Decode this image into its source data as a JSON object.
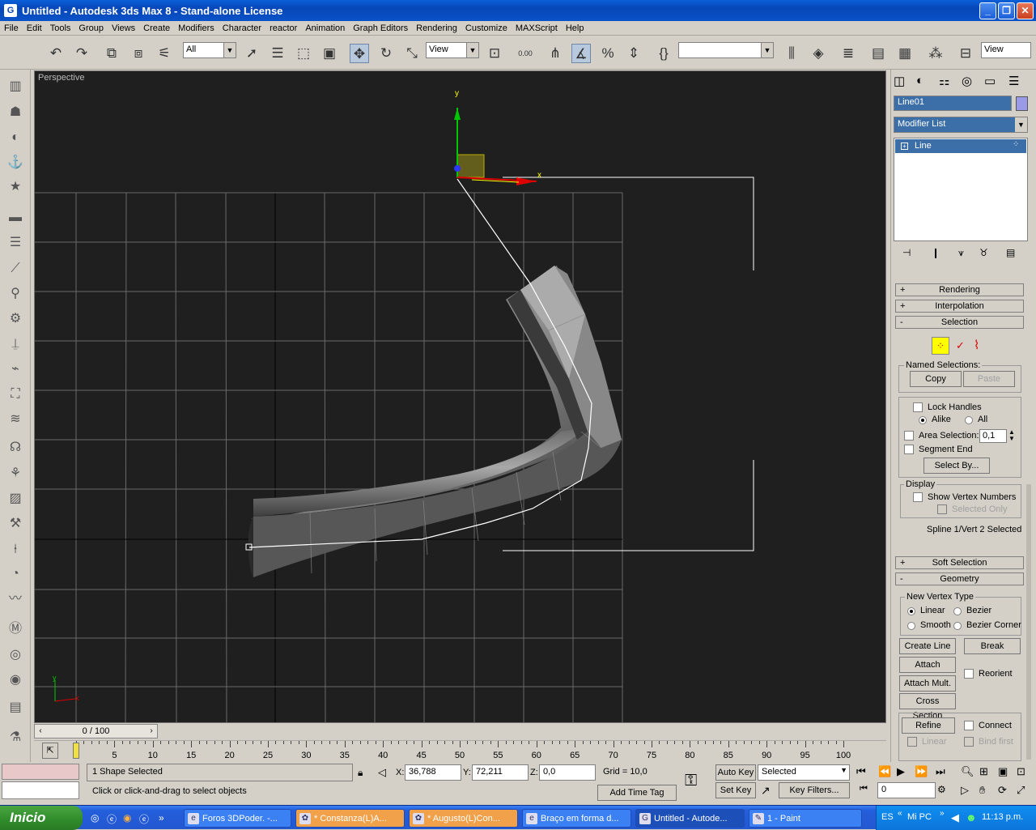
{
  "window": {
    "title": "Untitled - Autodesk 3ds Max 8  - Stand-alone License",
    "app_icon": "3ds-max-icon"
  },
  "menu": [
    "File",
    "Edit",
    "Tools",
    "Group",
    "Views",
    "Create",
    "Modifiers",
    "Character",
    "reactor",
    "Animation",
    "Graph Editors",
    "Rendering",
    "Customize",
    "MAXScript",
    "Help"
  ],
  "toolbar": {
    "filter_value": "All",
    "refcoord_value": "View",
    "spinner_value": "0.00",
    "view_right": "View"
  },
  "viewport": {
    "label": "Perspective",
    "axis_y": "y",
    "axis_x": "x"
  },
  "time": {
    "slider_label": "0 / 100",
    "ticks": [
      "5",
      "10",
      "15",
      "20",
      "25",
      "30",
      "35",
      "40",
      "45",
      "50",
      "55",
      "60",
      "65",
      "70",
      "75",
      "80",
      "85",
      "90",
      "95",
      "100"
    ]
  },
  "status": {
    "selection": "1 Shape Selected",
    "prompt": "Click or click-and-drag to select objects",
    "x_label": "X:",
    "x_value": "36,788",
    "y_label": "Y:",
    "y_value": "72,211",
    "z_label": "Z:",
    "z_value": "0,0",
    "grid": "Grid = 10,0",
    "add_time_tag": "Add Time Tag",
    "auto_key": "Auto Key",
    "set_key": "Set Key",
    "key_mode_value": "Selected",
    "key_filters": "Key Filters...",
    "frame_value": "0"
  },
  "panel": {
    "object_name": "Line01",
    "modifier_list": "Modifier List",
    "stack_item": "Line",
    "rollouts": {
      "rendering": "Rendering",
      "interpolation": "Interpolation",
      "selection": "Selection",
      "soft_selection": "Soft Selection",
      "geometry": "Geometry"
    },
    "named_selections": "Named Selections:",
    "copy": "Copy",
    "paste": "Paste",
    "lock_handles": "Lock Handles",
    "alike": "Alike",
    "all": "All",
    "area_selection": "Area Selection:",
    "area_value": "0,1",
    "segment_end": "Segment End",
    "select_by": "Select By...",
    "display": "Display",
    "show_vertex_numbers": "Show Vertex Numbers",
    "selected_only": "Selected Only",
    "spline_status": "Spline 1/Vert 2 Selected",
    "new_vertex_type": "New Vertex Type",
    "linear": "Linear",
    "bezier": "Bezier",
    "smooth": "Smooth",
    "bezier_corner": "Bezier Corner",
    "create_line": "Create Line",
    "break": "Break",
    "attach": "Attach",
    "reorient": "Reorient",
    "attach_mult": "Attach Mult.",
    "cross_section": "Cross Section",
    "refine": "Refine",
    "connect": "Connect",
    "linear2": "Linear",
    "bind_first": "Bind first"
  },
  "taskbar": {
    "start": "Inicio",
    "tasks": [
      "Foros 3DPoder. -...",
      "* Constanza(L)A...",
      "* Augusto(L)Con...",
      "Braço em forma d...",
      "Untitled - Autode...",
      "1 - Paint"
    ],
    "lang": "ES",
    "mypc": "Mi PC",
    "clock": "11:13 p.m."
  },
  "colors": {
    "titlebar": "#0a53c8",
    "viewport_bg": "#1f1f1f",
    "selection_blue": "#3c6ea8",
    "vertex_yellow": "#ffff00",
    "taskbar": "#245edb",
    "start_green": "#2f8c2a"
  }
}
